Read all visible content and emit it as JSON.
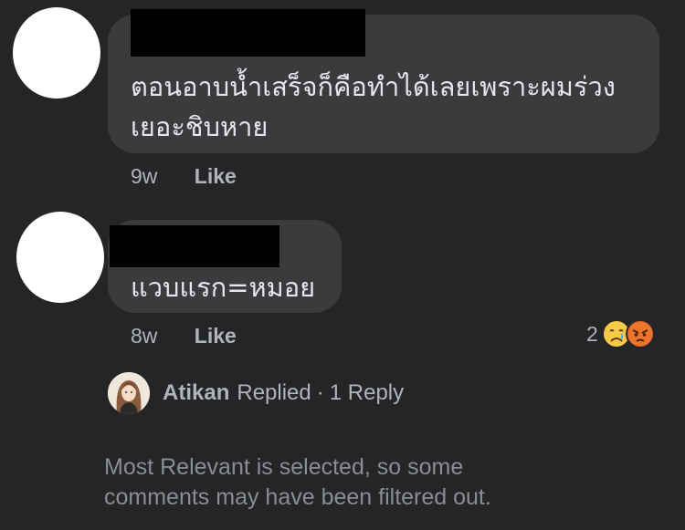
{
  "comment1": {
    "text_line1": "ตอนอาบน้ำเสร็จก็คือทำได้เลยเพราะผมร่วง",
    "text_line2": "เยอะชิบหาย",
    "time": "9w",
    "like_label": "Like"
  },
  "comment2": {
    "text": "แวบแรก=หมอย",
    "time": "8w",
    "like_label": "Like",
    "reaction_count": "2",
    "reactions": [
      "sad-face-icon",
      "angry-face-icon"
    ]
  },
  "reply_summary": {
    "name": "Atikan",
    "action": "Replied",
    "separator": "·",
    "count_label": "1 Reply"
  },
  "footer": {
    "line1": "Most Relevant is selected, so some",
    "line2": "comments may have been filtered out."
  },
  "colors": {
    "background": "#242526",
    "bubble": "#3a3b3c",
    "primary_text": "#e4e6eb",
    "secondary_text": "#b0b3b8"
  }
}
